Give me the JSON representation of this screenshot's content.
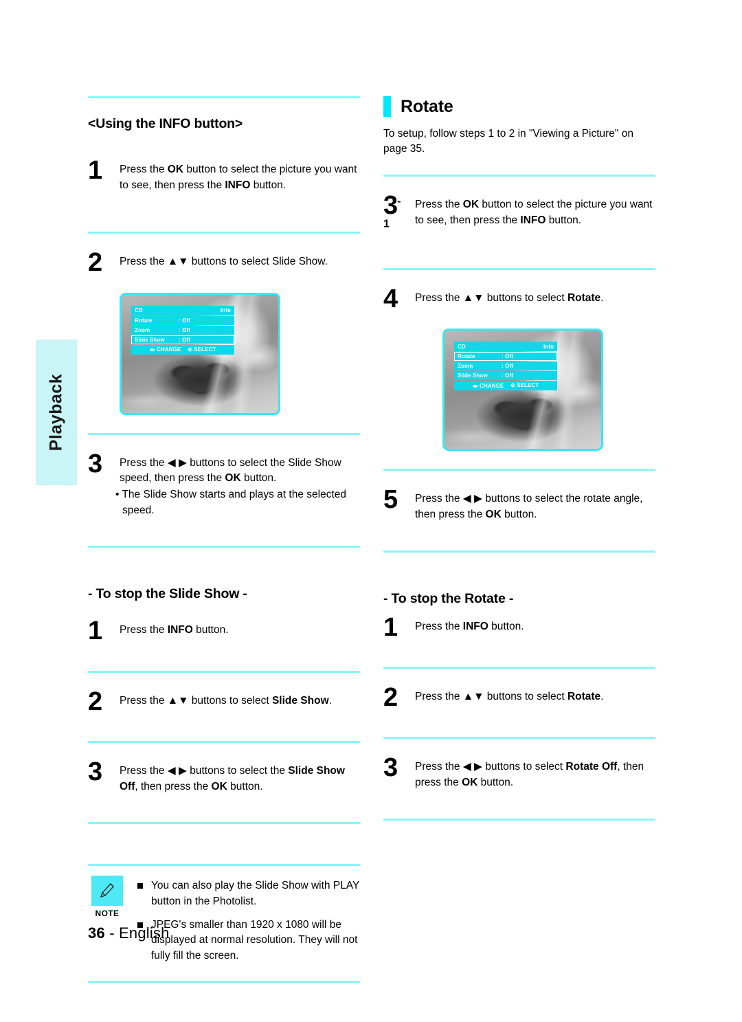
{
  "side_tab": {
    "label": "Playback"
  },
  "footer": {
    "page_number": "36",
    "separator": "-",
    "language": "English"
  },
  "osd": {
    "title": "CD",
    "info": "Info",
    "rows": [
      {
        "label": "Rotate",
        "value": ": Off"
      },
      {
        "label": "Zoom",
        "value": ": Off"
      },
      {
        "label": "Slide Show",
        "value": ": Off"
      }
    ],
    "change": "CHANGE",
    "select": "SELECT",
    "change_icon": "left-right-arrows-icon",
    "select_icon": "enter-key-icon",
    "accent_color": "#11d8e8",
    "bezel_color": "#39e8f2"
  },
  "left_column": {
    "heading": "<Using the INFO button>",
    "step1": {
      "number": "1",
      "text_parts": [
        "Press the ",
        "OK",
        " button to select the picture you want to see, then press the ",
        "INFO",
        " button."
      ]
    },
    "step2": {
      "number": "2",
      "text": "Press the ▲▼ buttons to select Slide Show."
    },
    "step3": {
      "number": "3",
      "line1_a": "Press the ◀ ▶ buttons to select the Slide Show speed, then press the ",
      "line1_b": "OK",
      "line1_c": " button.",
      "bullet": "• The Slide Show starts and plays at the selected speed."
    },
    "stop_heading": "- To stop the Slide Show -",
    "stop_step1": {
      "number": "1",
      "a": "Press the ",
      "b": "INFO",
      "c": " button."
    },
    "stop_step2": {
      "number": "2",
      "a": "Press the ▲▼ buttons to select ",
      "b": "Slide Show",
      "c": "."
    },
    "stop_step3": {
      "number": "3",
      "a": "Press the ◀ ▶ buttons to select the ",
      "b": "Slide Show Off",
      "c": ", then press the ",
      "d": "OK",
      "e": " button."
    }
  },
  "right_column": {
    "section_title": "Rotate",
    "intro": "To setup, follow steps 1 to 2 in \"Viewing a Picture\" on page 35.",
    "step31": {
      "number": "3",
      "superscript": "-1",
      "a": "Press the ",
      "b": "OK",
      "c": " button to select the picture you want to see, then press the ",
      "d": "INFO",
      "e": " button."
    },
    "step4": {
      "number": "4",
      "a": "Press the ▲▼ buttons to select ",
      "b": "Rotate",
      "c": "."
    },
    "step5": {
      "number": "5",
      "a": "Press the ◀ ▶ buttons to select the rotate angle, then press the ",
      "b": "OK",
      "c": " button."
    },
    "stop_heading": "- To stop the Rotate -",
    "stop_step1": {
      "number": "1",
      "a": "Press the ",
      "b": "INFO",
      "c": " button."
    },
    "stop_step2": {
      "number": "2",
      "a": "Press the ▲▼ buttons to select ",
      "b": "Rotate",
      "c": "."
    },
    "stop_step3": {
      "number": "3",
      "a": "Press the ◀ ▶ buttons to select ",
      "b": "Rotate Off",
      "c": ", then press the ",
      "d": "OK",
      "e": " button."
    }
  },
  "note": {
    "word": "NOTE",
    "icon": "pencil-icon",
    "items": [
      "You can also play the Slide Show with PLAY button in the Photolist.",
      "JPEG's smaller than 1920 x 1080 will be displayed at normal resolution. They will not fully fill the screen."
    ]
  }
}
